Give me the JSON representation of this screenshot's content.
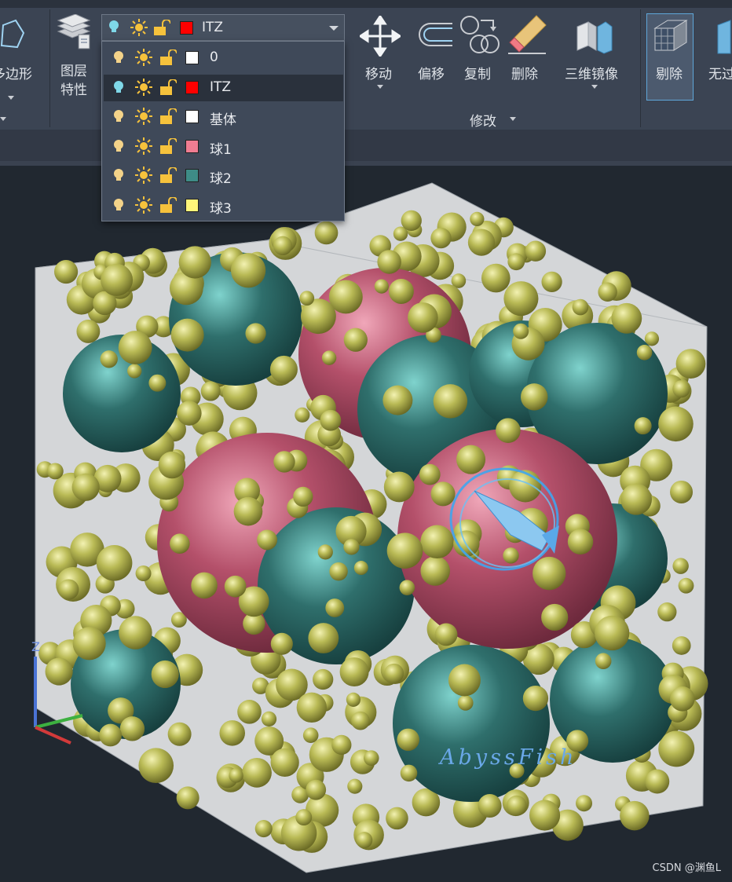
{
  "ribbon": {
    "polygon_label": "多边形",
    "layer_props_label_line1": "图层",
    "layer_props_label_line2": "特性",
    "move_label": "移动",
    "offset_label": "偏移",
    "copy_label": "复制",
    "erase_label": "删除",
    "mirror3d_label": "三维镜像",
    "modify_panel_label": "修改",
    "remove_label": "剔除",
    "noclip_label": "无过"
  },
  "layer_combo": {
    "current_name": "ITZ",
    "current_color": "#ff0000"
  },
  "layers": [
    {
      "name": "0",
      "color": "#ffffff",
      "light": "off"
    },
    {
      "name": "ITZ",
      "color": "#ff0000",
      "light": "on",
      "selected": true
    },
    {
      "name": "基体",
      "color": "#ffffff",
      "light": "off"
    },
    {
      "name": "球1",
      "color": "#f07d92",
      "light": "off"
    },
    {
      "name": "球2",
      "color": "#3e8c87",
      "light": "off"
    },
    {
      "name": "球3",
      "color": "#fff57a",
      "light": "off"
    }
  ],
  "viewport": {
    "watermark": "AbyssFish",
    "ucs_z_label": "Z",
    "credit": "CSDN @渊鱼L",
    "colors": {
      "teal": "#2f6f6c",
      "pink": "#b4506a",
      "yellow": "#b9ba55",
      "box": "#d4d6d8"
    }
  }
}
